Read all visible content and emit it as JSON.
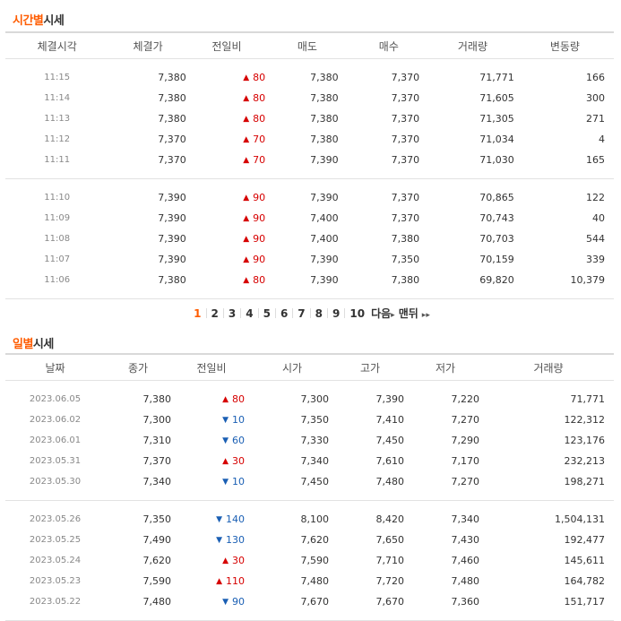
{
  "time_section": {
    "title_accent": "시간별",
    "title_rest": "시세",
    "headers": [
      "체결시각",
      "체결가",
      "전일비",
      "매도",
      "매수",
      "거래량",
      "변동량"
    ],
    "group1": [
      {
        "time": "11:15",
        "price": "7,380",
        "dir": "up",
        "change": "80",
        "sell": "7,380",
        "buy": "7,370",
        "volume": "71,771",
        "delta": "166"
      },
      {
        "time": "11:14",
        "price": "7,380",
        "dir": "up",
        "change": "80",
        "sell": "7,380",
        "buy": "7,370",
        "volume": "71,605",
        "delta": "300"
      },
      {
        "time": "11:13",
        "price": "7,380",
        "dir": "up",
        "change": "80",
        "sell": "7,380",
        "buy": "7,370",
        "volume": "71,305",
        "delta": "271"
      },
      {
        "time": "11:12",
        "price": "7,370",
        "dir": "up",
        "change": "70",
        "sell": "7,380",
        "buy": "7,370",
        "volume": "71,034",
        "delta": "4"
      },
      {
        "time": "11:11",
        "price": "7,370",
        "dir": "up",
        "change": "70",
        "sell": "7,390",
        "buy": "7,370",
        "volume": "71,030",
        "delta": "165"
      }
    ],
    "group2": [
      {
        "time": "11:10",
        "price": "7,390",
        "dir": "up",
        "change": "90",
        "sell": "7,390",
        "buy": "7,370",
        "volume": "70,865",
        "delta": "122"
      },
      {
        "time": "11:09",
        "price": "7,390",
        "dir": "up",
        "change": "90",
        "sell": "7,400",
        "buy": "7,370",
        "volume": "70,743",
        "delta": "40"
      },
      {
        "time": "11:08",
        "price": "7,390",
        "dir": "up",
        "change": "90",
        "sell": "7,400",
        "buy": "7,380",
        "volume": "70,703",
        "delta": "544"
      },
      {
        "time": "11:07",
        "price": "7,390",
        "dir": "up",
        "change": "90",
        "sell": "7,390",
        "buy": "7,350",
        "volume": "70,159",
        "delta": "339"
      },
      {
        "time": "11:06",
        "price": "7,380",
        "dir": "up",
        "change": "80",
        "sell": "7,390",
        "buy": "7,380",
        "volume": "69,820",
        "delta": "10,379"
      }
    ]
  },
  "pagination": {
    "pages": [
      "1",
      "2",
      "3",
      "4",
      "5",
      "6",
      "7",
      "8",
      "9",
      "10"
    ],
    "current": "1",
    "next_label": "다음",
    "last_label": "맨뒤",
    "arrow_next": "▸",
    "arrow_last": "▸▸"
  },
  "daily_section": {
    "title_accent": "일별",
    "title_rest": "시세",
    "headers": [
      "날짜",
      "종가",
      "전일비",
      "시가",
      "고가",
      "저가",
      "거래량"
    ],
    "group1": [
      {
        "date": "2023.06.05",
        "close": "7,380",
        "dir": "up",
        "change": "80",
        "open": "7,300",
        "high": "7,390",
        "low": "7,220",
        "volume": "71,771"
      },
      {
        "date": "2023.06.02",
        "close": "7,300",
        "dir": "down",
        "change": "10",
        "open": "7,350",
        "high": "7,410",
        "low": "7,270",
        "volume": "122,312"
      },
      {
        "date": "2023.06.01",
        "close": "7,310",
        "dir": "down",
        "change": "60",
        "open": "7,330",
        "high": "7,450",
        "low": "7,290",
        "volume": "123,176"
      },
      {
        "date": "2023.05.31",
        "close": "7,370",
        "dir": "up",
        "change": "30",
        "open": "7,340",
        "high": "7,610",
        "low": "7,170",
        "volume": "232,213"
      },
      {
        "date": "2023.05.30",
        "close": "7,340",
        "dir": "down",
        "change": "10",
        "open": "7,450",
        "high": "7,480",
        "low": "7,270",
        "volume": "198,271"
      }
    ],
    "group2": [
      {
        "date": "2023.05.26",
        "close": "7,350",
        "dir": "down",
        "change": "140",
        "open": "8,100",
        "high": "8,420",
        "low": "7,340",
        "volume": "1,504,131"
      },
      {
        "date": "2023.05.25",
        "close": "7,490",
        "dir": "down",
        "change": "130",
        "open": "7,620",
        "high": "7,650",
        "low": "7,430",
        "volume": "192,477"
      },
      {
        "date": "2023.05.24",
        "close": "7,620",
        "dir": "up",
        "change": "30",
        "open": "7,590",
        "high": "7,710",
        "low": "7,460",
        "volume": "145,611"
      },
      {
        "date": "2023.05.23",
        "close": "7,590",
        "dir": "up",
        "change": "110",
        "open": "7,480",
        "high": "7,720",
        "low": "7,480",
        "volume": "164,782"
      },
      {
        "date": "2023.05.22",
        "close": "7,480",
        "dir": "down",
        "change": "90",
        "open": "7,670",
        "high": "7,670",
        "low": "7,360",
        "volume": "151,717"
      }
    ]
  },
  "colors": {
    "accent": "#ff5c00",
    "up": "#d60000",
    "down": "#1a5fb4"
  },
  "icons": {
    "up": "triangle-up-icon",
    "down": "triangle-down-icon"
  }
}
